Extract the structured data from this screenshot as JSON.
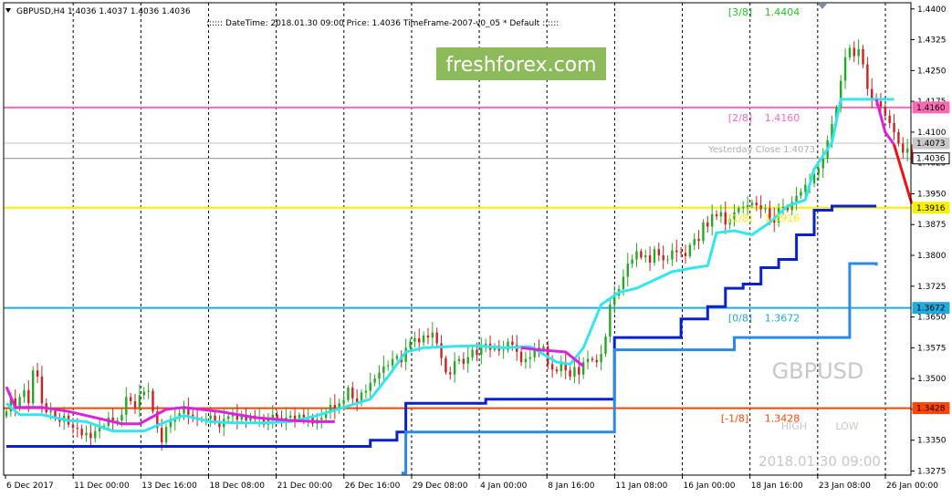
{
  "header": {
    "symbol": "GBPUSD,H4",
    "ohlc": "1.4036 1.4037 1.4036 1.4036",
    "info": ":::::: DateTime: 2018.01.30 09:00    Price: 1.4036    TimeFrame-2007-v0_05    *  Default  ::::::"
  },
  "watermark": {
    "brand": "freshforex.com",
    "symbol": "GBPUSD",
    "datetime": "2018.01.30 09:00",
    "high": "HIGH",
    "low": "LOW"
  },
  "colors": {
    "bull": "#22aa22",
    "bear": "#cc2222",
    "cyan_line": "#33e6ee",
    "magenta_line": "#dd22dd",
    "navy_line": "#0a22cc",
    "blue_line": "#2a8ae8",
    "red_projection": "#ee1111",
    "murrey_2_8": "#ff69b4",
    "murrey_1_8": "#f6f000",
    "murrey_0_8": "#22aadd",
    "murrey_m1_8": "#ff4500",
    "yesterday_close": "#c0c0c0",
    "current_price": "#909090"
  },
  "chart_data": {
    "type": "candlestick",
    "symbol": "GBPUSD",
    "timeframe": "H4",
    "ylim": [
      1.3265,
      1.4415
    ],
    "yticks": [
      "1.4400",
      "1.4325",
      "1.4250",
      "1.4175",
      "1.4100",
      "1.4025",
      "1.3950",
      "1.3875",
      "1.3800",
      "1.3725",
      "1.3650",
      "1.3575",
      "1.3500",
      "1.3425",
      "1.3350",
      "1.3275"
    ],
    "xticks": [
      "6 Dec 2017",
      "11 Dec 00:00",
      "13 Dec 16:00",
      "18 Dec 08:00",
      "21 Dec 00:00",
      "26 Dec 16:00",
      "29 Dec 08:00",
      "4 Jan 00:00",
      "8 Jan 16:00",
      "11 Jan 08:00",
      "16 Jan 00:00",
      "18 Jan 16:00",
      "23 Jan 08:00",
      "26 Jan 00:00"
    ],
    "grid": "vertical dashed",
    "murrey_levels": [
      {
        "label": "[3/8]",
        "value": 1.4404,
        "value_text": "1.4404",
        "axis_text": ""
      },
      {
        "label": "[2/8]",
        "value": 1.416,
        "value_text": "1.4160",
        "axis_text": "1.4160"
      },
      {
        "label": "[1/8]",
        "value": 1.3916,
        "value_text": "1.3916",
        "axis_text": "1.3916"
      },
      {
        "label": "[0/8]",
        "value": 1.3672,
        "value_text": "1.3672",
        "axis_text": "1.3672"
      },
      {
        "label": "[-1/8]",
        "value": 1.3428,
        "value_text": "1.3428",
        "axis_text": "1.3428"
      }
    ],
    "yesterday_close": {
      "label": "Yesterday Close",
      "value": 1.4073,
      "value_text": "1.4073"
    },
    "current_price": {
      "value": 1.4036,
      "value_text": "1.4036"
    },
    "cyan_trail": [
      [
        0,
        1.344
      ],
      [
        3,
        1.3412
      ],
      [
        8,
        1.3412
      ],
      [
        14,
        1.3398
      ],
      [
        18,
        1.3395
      ],
      [
        24,
        1.3372
      ],
      [
        31,
        1.3372
      ],
      [
        36,
        1.3395
      ],
      [
        40,
        1.341
      ],
      [
        46,
        1.3395
      ],
      [
        52,
        1.3392
      ],
      [
        58,
        1.3392
      ],
      [
        64,
        1.3395
      ],
      [
        70,
        1.341
      ],
      [
        76,
        1.343
      ],
      [
        82,
        1.345
      ],
      [
        86,
        1.3505
      ],
      [
        90,
        1.3565
      ],
      [
        94,
        1.3575
      ],
      [
        100,
        1.3578
      ],
      [
        106,
        1.358
      ],
      [
        112,
        1.3575
      ],
      [
        118,
        1.3578
      ],
      [
        124,
        1.354
      ],
      [
        127,
        1.3535
      ],
      [
        130,
        1.3575
      ],
      [
        134,
        1.368
      ],
      [
        138,
        1.371
      ],
      [
        142,
        1.372
      ],
      [
        146,
        1.374
      ],
      [
        150,
        1.376
      ],
      [
        154,
        1.3768
      ],
      [
        158,
        1.3775
      ],
      [
        160,
        1.3855
      ],
      [
        164,
        1.386
      ],
      [
        168,
        1.385
      ],
      [
        172,
        1.388
      ],
      [
        176,
        1.392
      ],
      [
        180,
        1.3935
      ],
      [
        182,
        1.401
      ],
      [
        186,
        1.4075
      ],
      [
        188,
        1.418
      ],
      [
        200,
        1.418
      ]
    ],
    "magenta_segments": [
      [
        [
          0,
          1.348
        ],
        [
          2,
          1.343
        ],
        [
          8,
          1.343
        ],
        [
          14,
          1.342
        ],
        [
          20,
          1.3405
        ],
        [
          26,
          1.339
        ],
        [
          30,
          1.339
        ],
        [
          36,
          1.3425
        ],
        [
          40,
          1.343
        ],
        [
          48,
          1.342
        ],
        [
          56,
          1.3405
        ],
        [
          64,
          1.3398
        ],
        [
          70,
          1.3395
        ],
        [
          74,
          1.3395
        ]
      ],
      [
        [
          116,
          1.3575
        ],
        [
          120,
          1.357
        ],
        [
          126,
          1.3565
        ],
        [
          130,
          1.353
        ]
      ],
      [
        [
          196,
          1.418
        ],
        [
          198,
          1.41
        ],
        [
          200,
          1.407
        ]
      ]
    ],
    "navy_steps": [
      [
        0,
        1.3335
      ],
      [
        78,
        1.3335
      ],
      [
        82,
        1.335
      ],
      [
        88,
        1.337
      ],
      [
        90,
        1.344
      ],
      [
        106,
        1.344
      ],
      [
        108,
        1.345
      ],
      [
        120,
        1.345
      ],
      [
        136,
        1.345
      ],
      [
        137,
        1.36
      ],
      [
        150,
        1.36
      ],
      [
        152,
        1.3645
      ],
      [
        158,
        1.3675
      ],
      [
        162,
        1.372
      ],
      [
        166,
        1.373
      ],
      [
        170,
        1.377
      ],
      [
        174,
        1.379
      ],
      [
        178,
        1.385
      ],
      [
        182,
        1.391
      ],
      [
        186,
        1.392
      ],
      [
        196,
        1.392
      ]
    ],
    "blue_steps": [
      [
        89,
        1.327
      ],
      [
        90,
        1.337
      ],
      [
        136,
        1.337
      ],
      [
        137,
        1.357
      ],
      [
        162,
        1.357
      ],
      [
        164,
        1.36
      ],
      [
        188,
        1.36
      ],
      [
        190,
        1.378
      ],
      [
        196,
        1.3775
      ]
    ],
    "projection": [
      [
        200,
        1.407
      ],
      [
        204,
        1.3925
      ]
    ],
    "price_path": [
      1.342,
      1.3452,
      1.3428,
      1.3455,
      1.3472,
      1.344,
      1.352,
      1.3505,
      1.344,
      1.3418,
      1.3422,
      1.3402,
      1.3395,
      1.341,
      1.3388,
      1.338,
      1.3378,
      1.3362,
      1.3368,
      1.3355,
      1.3372,
      1.338,
      1.3385,
      1.3405,
      1.3392,
      1.3398,
      1.3412,
      1.3455,
      1.3445,
      1.343,
      1.346,
      1.3468,
      1.347,
      1.342,
      1.338,
      1.3345,
      1.3382,
      1.3395,
      1.3405,
      1.3415,
      1.3428,
      1.3412,
      1.3405,
      1.3402,
      1.3398,
      1.3402,
      1.341,
      1.3395,
      1.3382,
      1.3402,
      1.3408,
      1.3412,
      1.34,
      1.341,
      1.3398,
      1.341,
      1.3402,
      1.3406,
      1.3388,
      1.34,
      1.3412,
      1.3404,
      1.3398,
      1.3405,
      1.341,
      1.3399,
      1.3412,
      1.3402,
      1.3406,
      1.339,
      1.34,
      1.3404,
      1.3418,
      1.3436,
      1.3425,
      1.344,
      1.3448,
      1.3478,
      1.3452,
      1.344,
      1.3466,
      1.347,
      1.349,
      1.35,
      1.3514,
      1.353,
      1.3532,
      1.3548,
      1.3555,
      1.354,
      1.3575,
      1.359,
      1.3598,
      1.3588,
      1.3605,
      1.36,
      1.3612,
      1.3586,
      1.355,
      1.3515,
      1.351,
      1.3542,
      1.3548,
      1.3536,
      1.3552,
      1.357,
      1.3558,
      1.3575,
      1.3585,
      1.357,
      1.358,
      1.3568,
      1.357,
      1.359,
      1.3582,
      1.3565,
      1.354,
      1.3548,
      1.3552,
      1.3575,
      1.357,
      1.3578,
      1.3535,
      1.3522,
      1.3518,
      1.354,
      1.352,
      1.3505,
      1.3528,
      1.351,
      1.354,
      1.3548,
      1.3545,
      1.354,
      1.356,
      1.3602,
      1.368,
      1.3702,
      1.3718,
      1.3748,
      1.378,
      1.379,
      1.381,
      1.3795,
      1.38,
      1.3782,
      1.3815,
      1.38,
      1.3788,
      1.379,
      1.3812,
      1.3808,
      1.3806,
      1.3798,
      1.3825,
      1.384,
      1.3835,
      1.388,
      1.387,
      1.39,
      1.3895,
      1.3905,
      1.3875,
      1.3888,
      1.3905,
      1.3915,
      1.3918,
      1.3922,
      1.3928,
      1.3922,
      1.3912,
      1.3915,
      1.389,
      1.388,
      1.3915,
      1.3918,
      1.391,
      1.393,
      1.3945,
      1.3955,
      1.3972,
      1.3975,
      1.3998,
      1.4012,
      1.4035,
      1.408,
      1.412,
      1.416,
      1.4225,
      1.4282,
      1.4305,
      1.4285,
      1.4302,
      1.4265,
      1.4205,
      1.4182,
      1.4175,
      1.4162,
      1.414,
      1.4122,
      1.41,
      1.4072,
      1.405,
      1.406,
      1.4036
    ]
  }
}
